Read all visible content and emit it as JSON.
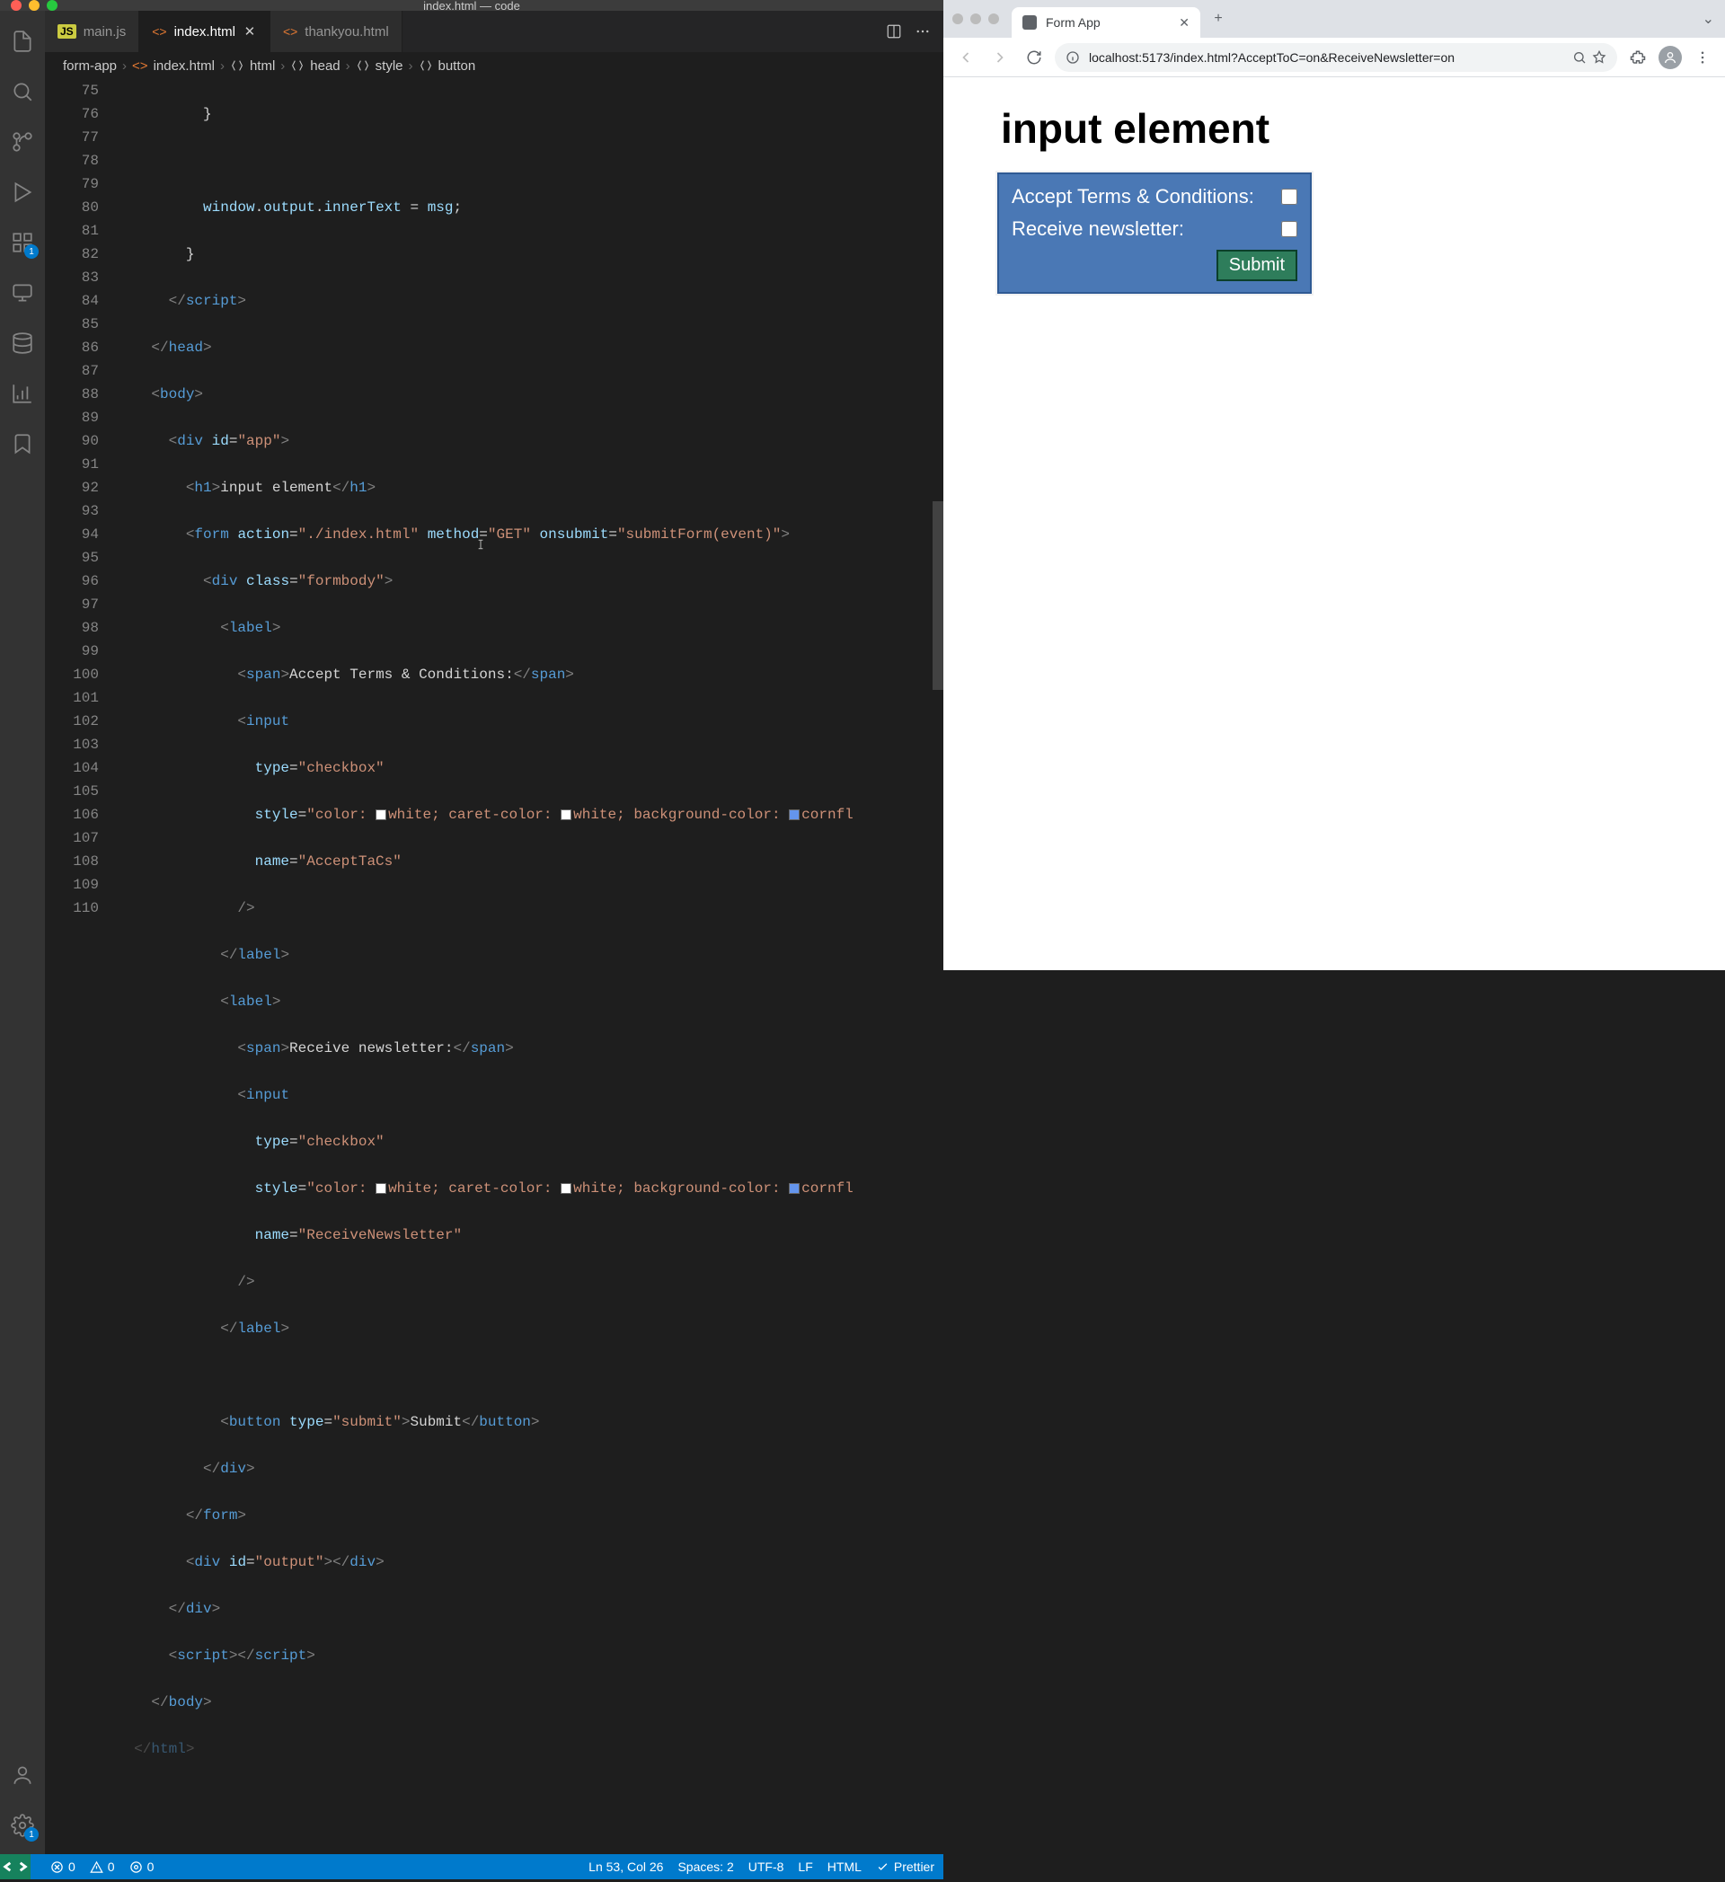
{
  "vscode": {
    "titlebar": "index.html — code",
    "tabs": [
      {
        "label": "main.js",
        "icon": "js",
        "active": false,
        "dirty": false
      },
      {
        "label": "index.html",
        "icon": "html",
        "active": true,
        "dirty": false
      },
      {
        "label": "thankyou.html",
        "icon": "html",
        "active": false,
        "dirty": false
      }
    ],
    "breadcrumb": [
      "form-app",
      "index.html",
      "html",
      "head",
      "style",
      "button"
    ],
    "activity_badges": {
      "extensions": "1",
      "settings": "1"
    },
    "gutter_start": 75,
    "gutter_end": 110,
    "code": {
      "l75": "}",
      "l77_1": "window",
      "l77_2": "output",
      "l77_3": "innerText",
      "l77_4": "msg",
      "l78": "}",
      "l79": "script",
      "l80": "head",
      "l81": "body",
      "l82_tag": "div",
      "l82_attr": "id",
      "l82_val": "\"app\"",
      "l83_tag": "h1",
      "l83_txt": "input element",
      "l84_tag": "form",
      "l84_a1": "action",
      "l84_v1": "\"./index.html\"",
      "l84_a2": "method",
      "l84_v2": "\"GET\"",
      "l84_a3": "onsubmit",
      "l84_v3": "\"submitForm(event)\"",
      "l85_tag": "div",
      "l85_a": "class",
      "l85_v": "\"formbody\"",
      "l86": "label",
      "l87_tag": "span",
      "l87_txt": "Accept Terms & Conditions:",
      "l88": "input",
      "l89_a": "type",
      "l89_v": "\"checkbox\"",
      "l90_a": "style",
      "l90_v1": "\"color: ",
      "l90_white": "white",
      "l90_mid": "; caret-color: ",
      "l90_bg": "; background-color: ",
      "l90_cf": "cornfl",
      "l91_a": "name",
      "l91_v": "\"AcceptTaCs\"",
      "l92": "/>",
      "l93": "label",
      "l94": "label",
      "l95_tag": "span",
      "l95_txt": "Receive newsletter:",
      "l96": "input",
      "l97_a": "type",
      "l97_v": "\"checkbox\"",
      "l98_a": "style",
      "l99_a": "name",
      "l99_v": "\"ReceiveNewsletter\"",
      "l100": "/>",
      "l101": "label",
      "l103_tag": "button",
      "l103_a": "type",
      "l103_v": "\"submit\"",
      "l103_txt": "Submit",
      "l104": "div",
      "l105": "form",
      "l106_tag": "div",
      "l106_a": "id",
      "l106_v": "\"output\"",
      "l107": "div",
      "l108": "script",
      "l109": "body",
      "l110": "html"
    },
    "status": {
      "errors": "0",
      "warnings": "0",
      "port": "0",
      "cursor": "Ln 53, Col 26",
      "spaces": "Spaces: 2",
      "encoding": "UTF-8",
      "eol": "LF",
      "lang": "HTML",
      "prettier": "Prettier"
    }
  },
  "browser": {
    "tab_title": "Form App",
    "url": "localhost:5173/index.html?AcceptToC=on&ReceiveNewsletter=on",
    "page": {
      "heading": "input element",
      "row1": "Accept Terms & Conditions:",
      "row2": "Receive newsletter:",
      "submit": "Submit"
    }
  }
}
